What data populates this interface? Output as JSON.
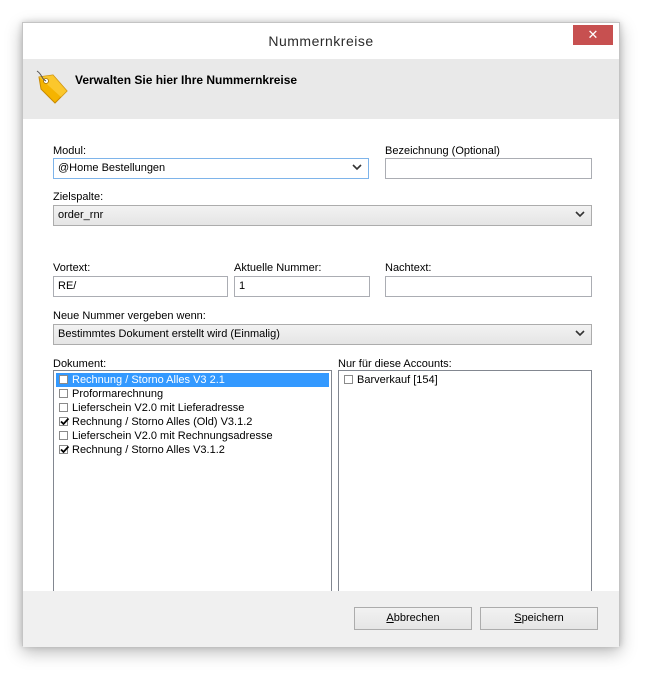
{
  "window": {
    "title": "Nummernkreise",
    "close_glyph": "✕"
  },
  "header": {
    "heading": "Verwalten Sie hier Ihre Nummernkreise",
    "icon": "tag-icon"
  },
  "form": {
    "modul_label": "Modul:",
    "modul_value": "@Home Bestellungen",
    "bezeichnung_label": "Bezeichnung (Optional)",
    "bezeichnung_value": "",
    "zielspalte_label": "Zielspalte:",
    "zielspalte_value": "order_rnr",
    "vortext_label": "Vortext:",
    "vortext_value": "RE/",
    "aktuelle_label": "Aktuelle Nummer:",
    "aktuelle_value": "1",
    "nachtext_label": "Nachtext:",
    "nachtext_value": "",
    "neue_label": "Neue Nummer vergeben wenn:",
    "neue_value": "Bestimmtes Dokument erstellt wird (Einmalig)"
  },
  "dokument": {
    "label": "Dokument:",
    "items": [
      {
        "label": "Rechnung / Storno Alles V3 2.1",
        "checked": false,
        "selected": true
      },
      {
        "label": "Proformarechnung",
        "checked": false,
        "selected": false
      },
      {
        "label": "Lieferschein V2.0 mit Lieferadresse",
        "checked": false,
        "selected": false
      },
      {
        "label": "Rechnung / Storno Alles (Old) V3.1.2",
        "checked": true,
        "selected": false
      },
      {
        "label": "Lieferschein V2.0 mit Rechnungsadresse",
        "checked": false,
        "selected": false
      },
      {
        "label": "Rechnung / Storno Alles V3.1.2",
        "checked": true,
        "selected": false
      }
    ]
  },
  "accounts": {
    "label": "Nur für diese Accounts:",
    "items": [
      {
        "label": "Barverkauf [154]",
        "checked": false
      }
    ]
  },
  "footer": {
    "cancel_access": "A",
    "cancel_rest": "bbrechen",
    "save_access": "S",
    "save_rest": "peichern"
  },
  "colors": {
    "selection": "#3399ff",
    "close": "#c75050",
    "accent_border": "#7eb4ea"
  }
}
